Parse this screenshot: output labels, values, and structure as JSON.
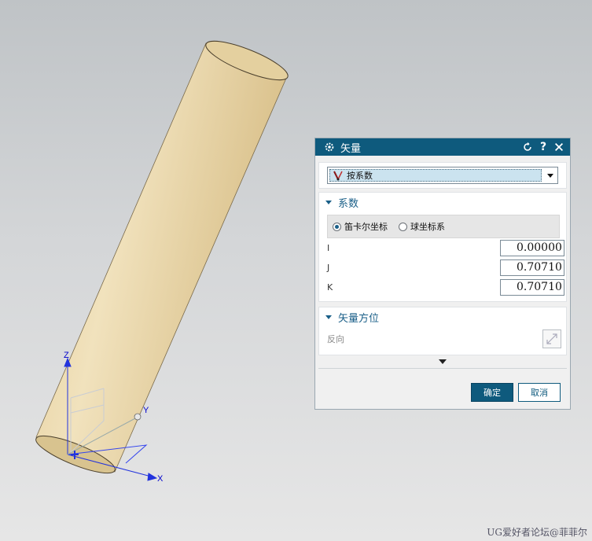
{
  "viewport": {
    "axes": {
      "x_label": "X",
      "y_label": "Y",
      "z_label": "Z"
    },
    "colors": {
      "cylinder_body": "#ead6a8",
      "cylinder_shade": "#c9b27b",
      "axis_blue": "#0000cc"
    }
  },
  "dialog": {
    "title": "矢量",
    "type_select": {
      "value": "按系数",
      "icon": "vector-coefficient-icon"
    },
    "coefficients_section": {
      "title": "系数",
      "coord_options": [
        {
          "label": "笛卡尔坐标",
          "selected": true
        },
        {
          "label": "球坐标系",
          "selected": false
        }
      ],
      "fields": [
        {
          "label": "I",
          "value": "0.00000"
        },
        {
          "label": "J",
          "value": "0.70710"
        },
        {
          "label": "K",
          "value": "0.70710"
        }
      ]
    },
    "orientation_section": {
      "title": "矢量方位",
      "reverse_label": "反向"
    },
    "ok_label": "确定",
    "cancel_label": "取消",
    "colors": {
      "title_bar": "#0e5a7d",
      "accent": "#1a5f88"
    }
  },
  "watermark": "UG爱好者论坛@菲菲尔"
}
